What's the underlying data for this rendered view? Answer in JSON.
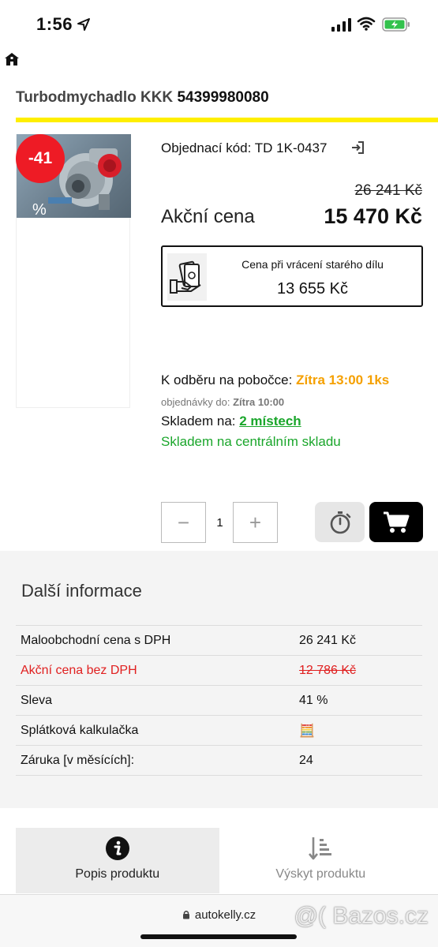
{
  "status_bar": {
    "time": "1:56"
  },
  "product": {
    "title_name": "Turbodmychadlo KKK",
    "title_code": "54399980080",
    "discount_badge": "-41",
    "percent_mark": "%",
    "order_code_label": "Objednací kód:",
    "order_code_value": "TD 1K-0437",
    "old_price": "26 241 Kč",
    "sale_label": "Akční cena",
    "sale_price": "15 470 Kč",
    "exchange_label": "Cena při vrácení starého dílu",
    "exchange_price": "13 655 Kč",
    "pickup_label": "K odběru na pobočce:",
    "pickup_value": "Zítra 13:00 1ks",
    "order_until_label": "objednávky do:",
    "order_until_value": "Zítra 10:00",
    "stock_label": "Skladem na:",
    "stock_link": "2 místech",
    "central_stock": "Skladem na centrálním skladu"
  },
  "cart": {
    "minus": "−",
    "plus": "+",
    "quantity": "1"
  },
  "info": {
    "title": "Další informace",
    "rows": [
      {
        "label": "Maloobchodní cena s DPH",
        "value": "26 241 Kč"
      },
      {
        "label": "Akční cena bez DPH",
        "value": "12 786 Kč"
      },
      {
        "label": "Sleva",
        "value": "41 %"
      },
      {
        "label": "Splátková kalkulačka",
        "value": "🧮"
      },
      {
        "label": "Záruka [v měsících]:",
        "value": "24"
      }
    ]
  },
  "tabs": [
    {
      "label": "Popis produktu",
      "icon": "info-icon"
    },
    {
      "label": "Výskyt produktu",
      "icon": "sort-list-icon"
    }
  ],
  "browser": {
    "url": "autokelly.cz"
  },
  "watermark": "@( Bazos.cz",
  "colors": {
    "accent_yellow": "#ffef00",
    "badge_red": "#ee1b25",
    "stock_green": "#1aa62b",
    "pickup_orange": "#f5a000",
    "strike_red": "#e02020"
  }
}
